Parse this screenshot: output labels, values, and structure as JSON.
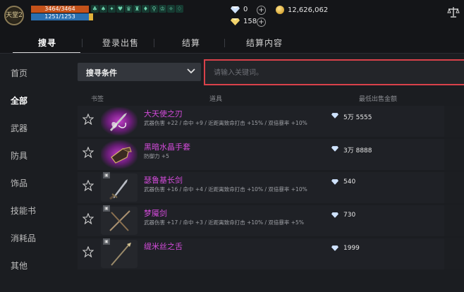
{
  "topbar": {
    "logo_text": "天堂2",
    "hp": "3464/3464",
    "mp": "1251/1253",
    "buff_icons": [
      "♣",
      "♠",
      "✦",
      "♥",
      "♛",
      "♜",
      "♦",
      "⚲",
      "♔",
      "✧",
      "♢"
    ],
    "diamond_count": "0",
    "gold_count": "12,626,062",
    "red_diamond_count": "158"
  },
  "tabs": [
    {
      "label": "搜寻",
      "active": true
    },
    {
      "label": "登录出售",
      "active": false
    },
    {
      "label": "结算",
      "active": false
    },
    {
      "label": "结算内容",
      "active": false
    }
  ],
  "sidebar": {
    "items": [
      {
        "label": "首页",
        "active": false
      },
      {
        "label": "全部",
        "active": true
      },
      {
        "label": "武器",
        "active": false
      },
      {
        "label": "防具",
        "active": false
      },
      {
        "label": "饰品",
        "active": false
      },
      {
        "label": "技能书",
        "active": false
      },
      {
        "label": "消耗品",
        "active": false
      },
      {
        "label": "其他",
        "active": false
      }
    ]
  },
  "search": {
    "condition_label": "搜寻条件",
    "placeholder": "请输入关键词。"
  },
  "table": {
    "headers": {
      "bookmark": "书签",
      "item": "道具",
      "price": "最低出售金额"
    },
    "rows": [
      {
        "name": "大天使之刃",
        "stats": "武器伤害 +22 / 命中 +9 / 近距离致命打击 +15% / 双倍暴率 +10%",
        "price": "5万 5555",
        "glow": true,
        "badge": false
      },
      {
        "name": "黑暗水晶手套",
        "stats": "防御力 +5",
        "price": "3万 8888",
        "glow": true,
        "badge": false
      },
      {
        "name": "瑟鲁基长剑",
        "stats": "武器伤害 +16 / 命中 +4 / 近距离致命打击 +10% / 双倍暴率 +10%",
        "price": "540",
        "glow": false,
        "badge": true
      },
      {
        "name": "梦魇剑",
        "stats": "武器伤害 +17 / 命中 +3 / 近距离致命打击 +10% / 双倍暴率 +5%",
        "price": "730",
        "glow": false,
        "badge": true
      },
      {
        "name": "缇米丝之舌",
        "stats": "",
        "price": "1999",
        "glow": false,
        "badge": true
      }
    ]
  },
  "colors": {
    "background": "#1b1d21",
    "item_name": "#d24bd9",
    "search_highlight": "#d9414a",
    "hp": "#c4521a",
    "mp": "#2a6fb0"
  },
  "icons": {
    "currency_diamond": "diamond-icon",
    "currency_gold": "gold-coin-icon",
    "currency_red": "red-diamond-icon",
    "top_right": "scale-icon",
    "bookmark": "star-icon",
    "dropdown": "chevron-down-icon"
  }
}
